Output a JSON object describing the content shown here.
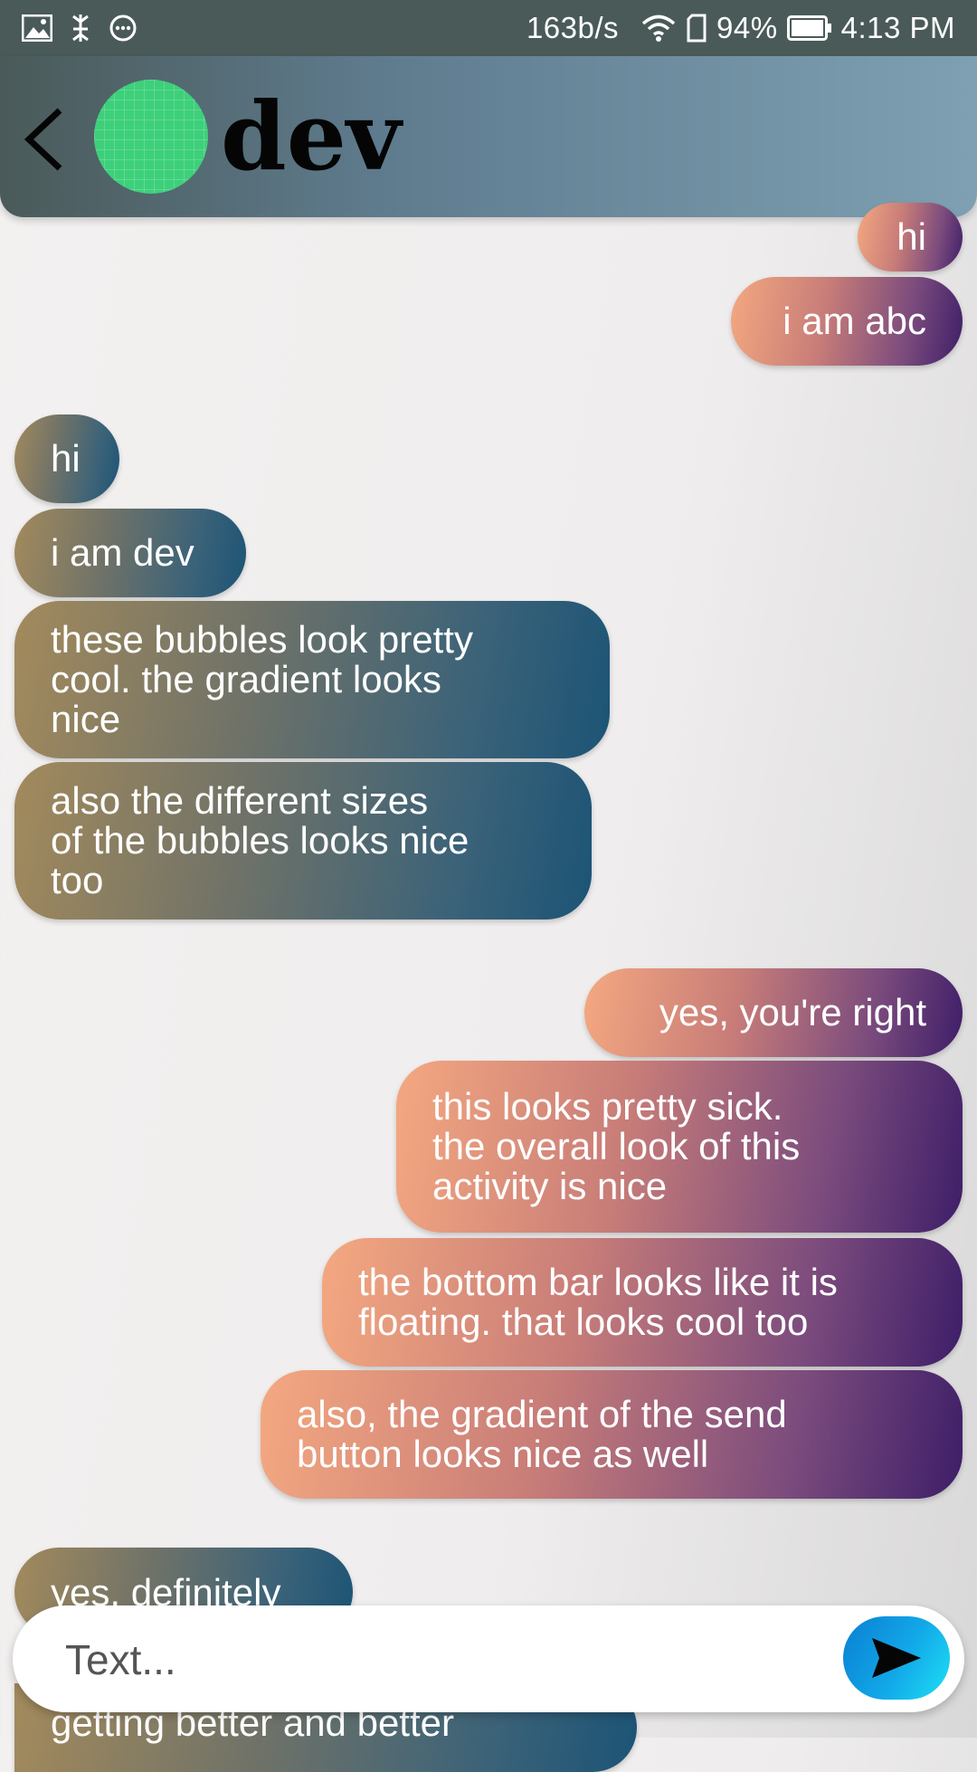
{
  "status_bar": {
    "network_speed": "163b/s",
    "battery_percent": "94%",
    "time": "4:13 PM",
    "icons": [
      "image-icon",
      "usb-debug-icon",
      "chat-notification-icon",
      "wifi-icon",
      "sim-icon",
      "battery-icon"
    ]
  },
  "header": {
    "contact_name": "dev",
    "avatar_color": "#3dd07a"
  },
  "messages": [
    {
      "from": "me",
      "text": "hi"
    },
    {
      "from": "me",
      "text": "i am abc"
    },
    {
      "from": "dev",
      "text": "hi"
    },
    {
      "from": "dev",
      "text": "i am dev"
    },
    {
      "from": "dev",
      "text": "these bubbles look pretty\ncool. the gradient looks\nnice"
    },
    {
      "from": "dev",
      "text": "also the different sizes\nof the bubbles looks nice\ntoo"
    },
    {
      "from": "me",
      "text": "yes, you're right"
    },
    {
      "from": "me",
      "text": "this looks pretty sick.\nthe overall look of this\nactivity is nice"
    },
    {
      "from": "me",
      "text": "the bottom bar looks like it is\nfloating. that looks cool too"
    },
    {
      "from": "me",
      "text": "also, the gradient of the send\nbutton looks nice as well"
    },
    {
      "from": "dev",
      "text": "yes, definitely"
    },
    {
      "from": "dev",
      "text": "getting better and better"
    }
  ],
  "composer": {
    "placeholder": "Text...",
    "value": "",
    "send_icon": "send-icon"
  },
  "colors": {
    "sent_gradient": [
      "#f4a880",
      "#3e1e68"
    ],
    "received_gradient": [
      "#a38a5c",
      "#1c5476"
    ],
    "send_button_gradient": [
      "#0a7fd2",
      "#1ee0f5"
    ]
  }
}
